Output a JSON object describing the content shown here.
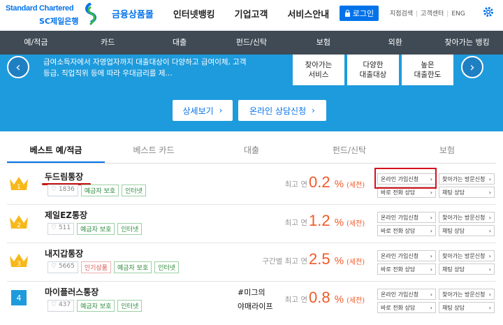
{
  "header": {
    "logo_line1": "Standard Chartered",
    "logo_line2": "SC제일은행",
    "nav": [
      "금융상품몰",
      "인터넷뱅킹",
      "기업고객",
      "서비스안내"
    ],
    "login_label": "로그인",
    "utils": [
      "지점검색",
      "고객센터",
      "ENG"
    ]
  },
  "subnav": [
    "예/적금",
    "카드",
    "대출",
    "펀드/신탁",
    "보험",
    "외환",
    "찾아가는 뱅킹"
  ],
  "banner": {
    "desc": "급여소득자에서 자영업자까지 대출대상이 다양하고 급여이체, 고객등급, 직업직위 등에 따라 우대금리를 제...",
    "features": [
      "찾아가는\n서비스",
      "다양한\n대출대상",
      "높은\n대출한도"
    ],
    "detail_button": "상세보기",
    "consult_button": "온라인 상담신청"
  },
  "tabs": [
    "베스트 예/적금",
    "베스트 카드",
    "대출",
    "펀드/신탁",
    "보험"
  ],
  "products": [
    {
      "rank": "1",
      "name": "두드림통장",
      "likes": "1836",
      "tags": [
        "예금자 보호",
        "인터넷"
      ],
      "rate_label": "최고 연",
      "rate": "0.2",
      "unit": "%",
      "tax": "(세전)"
    },
    {
      "rank": "2",
      "name": "제일EZ통장",
      "likes": "511",
      "tags": [
        "예금자 보호",
        "인터넷"
      ],
      "rate_label": "최고 연",
      "rate": "1.2",
      "unit": "%",
      "tax": "(세전)"
    },
    {
      "rank": "3",
      "name": "내지갑통장",
      "likes": "5665",
      "tags": [
        "인기상품",
        "예금자 보호",
        "인터넷"
      ],
      "rate_label": "구간별 최고 연",
      "rate": "2.5",
      "unit": "%",
      "tax": "(세전)"
    },
    {
      "rank": "4",
      "name": "마이플러스통장",
      "likes": "437",
      "tags": [
        "예금자 보호",
        "인터넷"
      ],
      "rate_label": "최고 연",
      "rate": "0.8",
      "unit": "%",
      "tax": "(세전)"
    }
  ],
  "action_labels": {
    "online_join": "온라인 가입신청",
    "visit": "찾아가는 방문신청",
    "phone": "바로 전화 상담",
    "chat": "채팅 상담"
  },
  "handwritten_note": {
    "line1": "#미그의",
    "line2": "야매라이프"
  },
  "colors": {
    "brand_blue": "#0473ea",
    "banner_blue": "#1e9bdc",
    "subnav_bg": "#3f4a54",
    "rate_orange": "#f05a28",
    "highlight_red": "#d4111c"
  }
}
